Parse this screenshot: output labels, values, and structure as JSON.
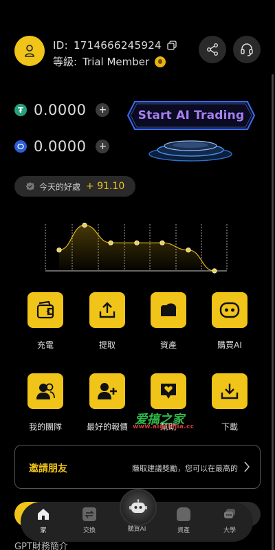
{
  "profile": {
    "id_label": "ID:",
    "id_value": "1714666245924",
    "level_label": "等級:",
    "level_value": "Trial Member"
  },
  "balances": [
    {
      "coin_icon": "tether-icon",
      "value": "0.0000",
      "color": "#26a17b"
    },
    {
      "coin_icon": "coin-icon",
      "value": "0.0000",
      "color": "#2c5fd6"
    }
  ],
  "trade_button": {
    "label": "Start AI Trading"
  },
  "profit": {
    "label": "今天的好處",
    "value": "+ 91.10"
  },
  "chart_data": {
    "type": "area",
    "x": [
      1,
      2,
      3,
      4,
      5,
      6,
      7
    ],
    "values": [
      2.6,
      5.7,
      3.5,
      3.5,
      3.5,
      2.6,
      0
    ],
    "ylim": [
      0,
      6
    ],
    "title": "",
    "xlabel": "",
    "ylabel": "",
    "grid": "vertical-dashed"
  },
  "actions": [
    {
      "label": "充電",
      "icon": "wallet-icon"
    },
    {
      "label": "提取",
      "icon": "upload-icon"
    },
    {
      "label": "資產",
      "icon": "assets-icon"
    },
    {
      "label": "購買AI",
      "icon": "robot-icon"
    },
    {
      "label": "我的團隊",
      "icon": "team-icon"
    },
    {
      "label": "最好的報價",
      "icon": "add-user-icon"
    },
    {
      "label": "幫助",
      "icon": "heart-chat-icon"
    },
    {
      "label": "下載",
      "icon": "download-icon"
    }
  ],
  "invite": {
    "title": "邀請朋友",
    "description": "賺取建議獎勵，您可以在最高的"
  },
  "gpt_section": {
    "title": "GPT財務簡介"
  },
  "watermark": {
    "title": "爱搞之家",
    "url": "www.aigzhijia.cc"
  },
  "nav": {
    "items": [
      {
        "label": "家",
        "icon": "home-icon"
      },
      {
        "label": "交換",
        "icon": "exchange-icon"
      },
      {
        "label": "購買AI",
        "icon": "robot-icon"
      },
      {
        "label": "資產",
        "icon": "assets-icon"
      },
      {
        "label": "大學",
        "icon": "chat-icon"
      }
    ]
  },
  "colors": {
    "accent": "#f0c419",
    "background": "#000000",
    "trade_text": "#a77ff0",
    "trade_border": "#3a6df0"
  }
}
